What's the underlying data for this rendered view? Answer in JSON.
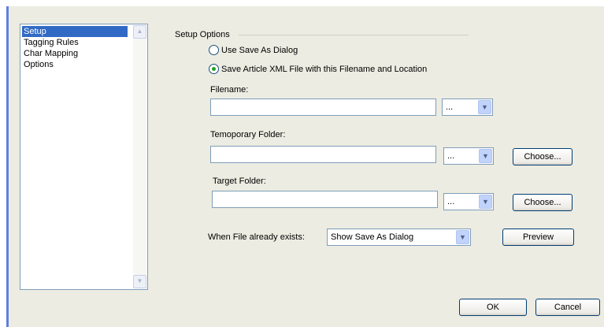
{
  "sidebar": {
    "items": [
      {
        "label": "Setup",
        "selected": true
      },
      {
        "label": "Tagging Rules",
        "selected": false
      },
      {
        "label": "Char Mapping",
        "selected": false
      },
      {
        "label": "Options",
        "selected": false
      }
    ]
  },
  "setup": {
    "group_title": "Setup Options",
    "radio_save_as_dialog": "Use Save As Dialog",
    "radio_save_xml": "Save Article XML File with this Filename and Location",
    "selected_radio": "radio_save_xml",
    "filename_label": "Filename:",
    "filename_value": "",
    "temporary_folder_label": "Temoporary Folder:",
    "temporary_folder_value": "",
    "target_folder_label": "Target Folder:",
    "target_folder_value": "",
    "combo_value": "...",
    "choose_label": "Choose...",
    "file_exists_label": "When File already exists:",
    "file_exists_value": "Show Save As Dialog",
    "preview_label": "Preview"
  },
  "footer": {
    "ok_label": "OK",
    "cancel_label": "Cancel"
  },
  "colors": {
    "dialog_bg": "#ecece2",
    "selection": "#316ac5",
    "radio_dot": "#21a121",
    "accent_edge": "#5e7ee0"
  }
}
